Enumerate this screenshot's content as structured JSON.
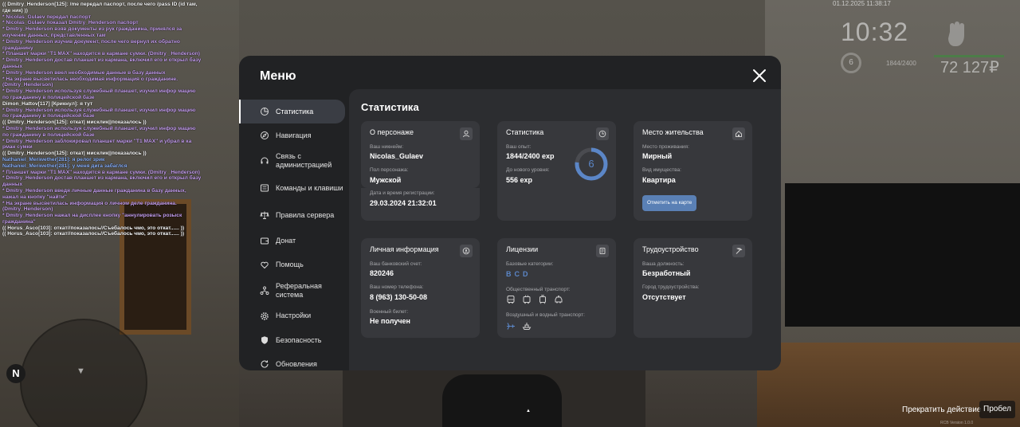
{
  "chat": [
    {
      "text": "(( Dmitry_Henderson[125]: /me передал паспорт, после чего /pass ID (id там, где ник) ))",
      "color": "white"
    },
    {
      "text": "* Nicolas_Gulaev передал паспорт",
      "color": "purple"
    },
    {
      "text": "* Nicolas_Gulaev показал Dmitry_Henderson паспорт",
      "color": "purple"
    },
    {
      "text": "* Dmitry_Henderson взяв документы из рук гражданина, принялся за изучение данных, представленных там",
      "color": "purple"
    },
    {
      "text": "* Dmitry_Henderson изучив документ, после чего вернул их обратно гражданину",
      "color": "purple"
    },
    {
      "text": "* Планшет марки \"T1 MAX\" находится в кармане сумки. (Dmitry _Henderson)",
      "color": "purple"
    },
    {
      "text": "* Dmitry_Henderson достав планшет из кармана, включил его и открыл базу данных",
      "color": "purple"
    },
    {
      "text": "* Dmitry_Henderson ввел необходимые данные в базу данных",
      "color": "purple"
    },
    {
      "text": "* На экране высветилась необходимая информация о гражданине. (Dmitry_Henderson)",
      "color": "purple"
    },
    {
      "text": "* Dmitry_Henderson используя служебный планшет, изучил инфор мацию по гражданину в полицейской базе",
      "color": "purple"
    },
    {
      "text": "Dimon_Hattov[117] [Крикнул]: я тут",
      "color": "white"
    },
    {
      "text": "* Dmitry_Henderson используя служебный планшет, изучил инфор мацию по гражданину в полицейской базе",
      "color": "purple"
    },
    {
      "text": "(( Dmitry_Henderson[125]: откат| мисклик||показалось ))",
      "color": "white"
    },
    {
      "text": "* Dmitry_Henderson используя служебный планшет, изучил инфор мацию по гражданину в полицейской базе",
      "color": "purple"
    },
    {
      "text": "* Dmitry_Henderson заблокировал планшет марки \"T1 MAX\" и убрал в ка рман сумки",
      "color": "purple"
    },
    {
      "text": "(( Dmitry_Henderson[125]: откат| мисклик||показалось ))",
      "color": "white"
    },
    {
      "text": "Nathaniel_Meriwether[281]: я релог зрик",
      "color": "blue"
    },
    {
      "text": "Nathaniel_Meriwether[281]: у меня дига забаглся",
      "color": "blue"
    },
    {
      "text": "* Планшет марки \"T1 MAX\" находится в кармане сумки. (Dmitry _Henderson)",
      "color": "purple"
    },
    {
      "text": "* Dmitry_Henderson достав планшет из кармана, включил его и открыл базу данных",
      "color": "purple"
    },
    {
      "text": "* Dmitry_Henderson введя личные данные гражданина в базу данных, нажал на кнопку \"найти\"",
      "color": "purple"
    },
    {
      "text": "* На экране высветилась информация о личном деле гражданина. (Dmitry_Henderson)",
      "color": "purple"
    },
    {
      "text": "* Dmitry_Henderson нажал на дисплее кнопку \"аннулировать розыск гражданина\"",
      "color": "purple"
    },
    {
      "text": "(( Horus_Asco[103]: откат//показалось//Съебалось чмо, это откат...... ))",
      "color": "white"
    },
    {
      "text": "(( Horus_Asco[103]: откат//показалось//Съебалось чмо, это откат...... ))",
      "color": "white"
    }
  ],
  "hud": {
    "date": "01.12.2025 11:38:17",
    "time": "10:32",
    "level": "6",
    "exp": "1844/2400",
    "money": "72 127₽"
  },
  "minimap": {
    "compass": "N"
  },
  "bottom": {
    "action": "Прекратить действие",
    "key": "Пробел",
    "version": "RCB Version 1.0.0"
  },
  "menu": {
    "title": "Меню",
    "nav": [
      {
        "label": "Статистика",
        "icon": "pie-chart-icon",
        "active": true
      },
      {
        "label": "Навигация",
        "icon": "compass-icon"
      },
      {
        "label": "Связь с администрацией",
        "icon": "headset-icon"
      },
      {
        "label": "Команды и клавиши",
        "icon": "keyboard-icon"
      },
      {
        "label": "Правила сервера",
        "icon": "scales-icon"
      },
      {
        "label": "Донат",
        "icon": "wallet-icon"
      },
      {
        "label": "Помощь",
        "icon": "heart-hand-icon"
      },
      {
        "label": "Реферальная система",
        "icon": "referral-icon"
      },
      {
        "label": "Настройки",
        "icon": "gear-icon"
      },
      {
        "label": "Безопасность",
        "icon": "shield-icon"
      },
      {
        "label": "Обновления",
        "icon": "refresh-icon"
      }
    ],
    "content_title": "Статистика",
    "cards": {
      "person": {
        "title": "О персонаже",
        "icon": "user-icon",
        "nickname_label": "Ваш никнейм:",
        "nickname": "Nicolas_Gulaev",
        "sex_label": "Пол персонажа:",
        "sex": "Мужской",
        "reg_label": "Дата и время регистрации:",
        "reg": "29.03.2024 21:32:01"
      },
      "stats": {
        "title": "Статистика",
        "icon": "clock-icon",
        "exp_label": "Ваш опыт:",
        "exp": "1844/2400 exp",
        "next_label": "До нового уровня:",
        "next": "556 exp",
        "level": "6",
        "progress": 0.768
      },
      "home": {
        "title": "Место жительства",
        "icon": "house-icon",
        "place_label": "Место проживания:",
        "place": "Мирный",
        "property_label": "Вид имущества:",
        "property": "Квартира",
        "button": "Отметить на карте"
      },
      "personal": {
        "title": "Личная информация",
        "icon": "id-circle-icon",
        "bank_label": "Ваш банковский счет:",
        "bank": "820246",
        "phone_label": "Ваш номер телефона:",
        "phone": "8 (963) 130-50-08",
        "military_label": "Военный билет:",
        "military": "Не получен"
      },
      "licenses": {
        "title": "Лицензии",
        "icon": "document-icon",
        "base_label": "Базовые категории:",
        "base": "BCD",
        "public_label": "Общественный транспорт:",
        "public_icons": [
          "bus-icon",
          "trolleybus-icon",
          "tram-icon",
          "taxi-icon"
        ],
        "air_label": "Воздушный и водный транспорт:",
        "air_icons": [
          "plane-icon",
          "boat-icon"
        ]
      },
      "job": {
        "title": "Трудоустройство",
        "icon": "pickaxe-icon",
        "position_label": "Ваша должность:",
        "position": "Безработный",
        "city_label": "Город трудоустройства:",
        "city": "Отсутствует"
      }
    }
  },
  "colors": {
    "accent": "#5a80b5",
    "panel": "#212224",
    "card": "#37383c",
    "chat_purple": "#c9a2f2",
    "chat_blue": "#8db4ff"
  }
}
